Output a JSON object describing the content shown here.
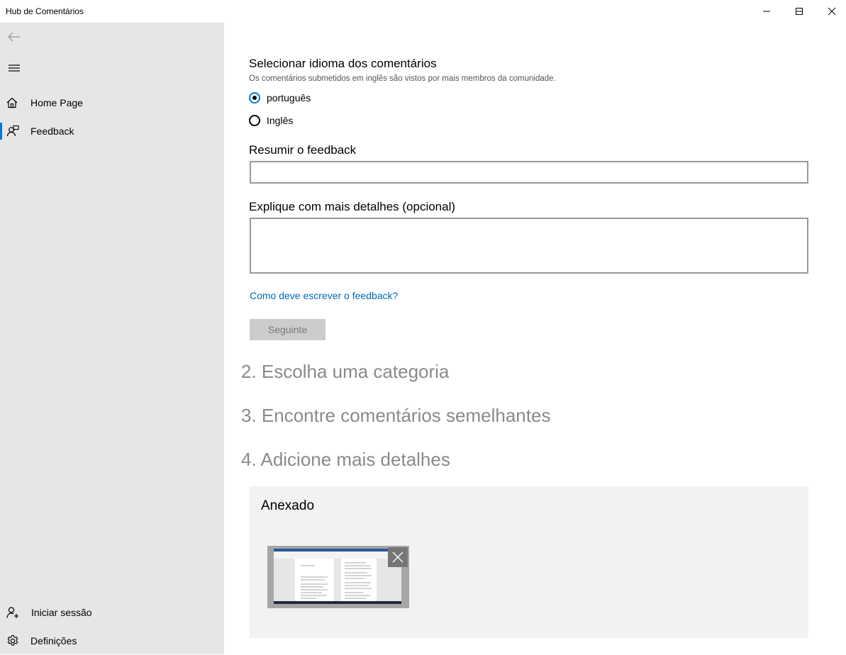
{
  "window": {
    "title": "Hub de Comentários"
  },
  "sidebar": {
    "items": [
      {
        "label": "Home Page",
        "icon": "home-icon"
      },
      {
        "label": "Feedback",
        "icon": "feedback-icon",
        "selected": true
      }
    ],
    "footer": [
      {
        "label": "Iniciar sessão",
        "icon": "add-person-icon"
      },
      {
        "label": "Definições",
        "icon": "gear-icon"
      }
    ]
  },
  "form": {
    "language_heading": "Selecionar idioma dos comentários",
    "language_subtext": "Os comentários submetidos em inglês são vistos por mais membros da comunidade.",
    "language_options": [
      {
        "label": "português",
        "checked": true
      },
      {
        "label": "Inglês",
        "checked": false
      }
    ],
    "summary_label": "Resumir o feedback",
    "summary_value": "",
    "details_label": "Explique com mais detalhes (opcional)",
    "details_value": "",
    "help_link": "Como deve escrever o feedback?",
    "next_button": "Seguinte"
  },
  "steps": [
    "2. Escolha uma categoria",
    "3. Encontre comentários semelhantes",
    "4. Adicione mais detalhes"
  ],
  "attachments": {
    "title": "Anexado"
  },
  "colors": {
    "accent": "#0078d7",
    "link": "#0067b8",
    "sidebar_bg": "#e6e6e6",
    "step_text": "#8a8a8a"
  }
}
